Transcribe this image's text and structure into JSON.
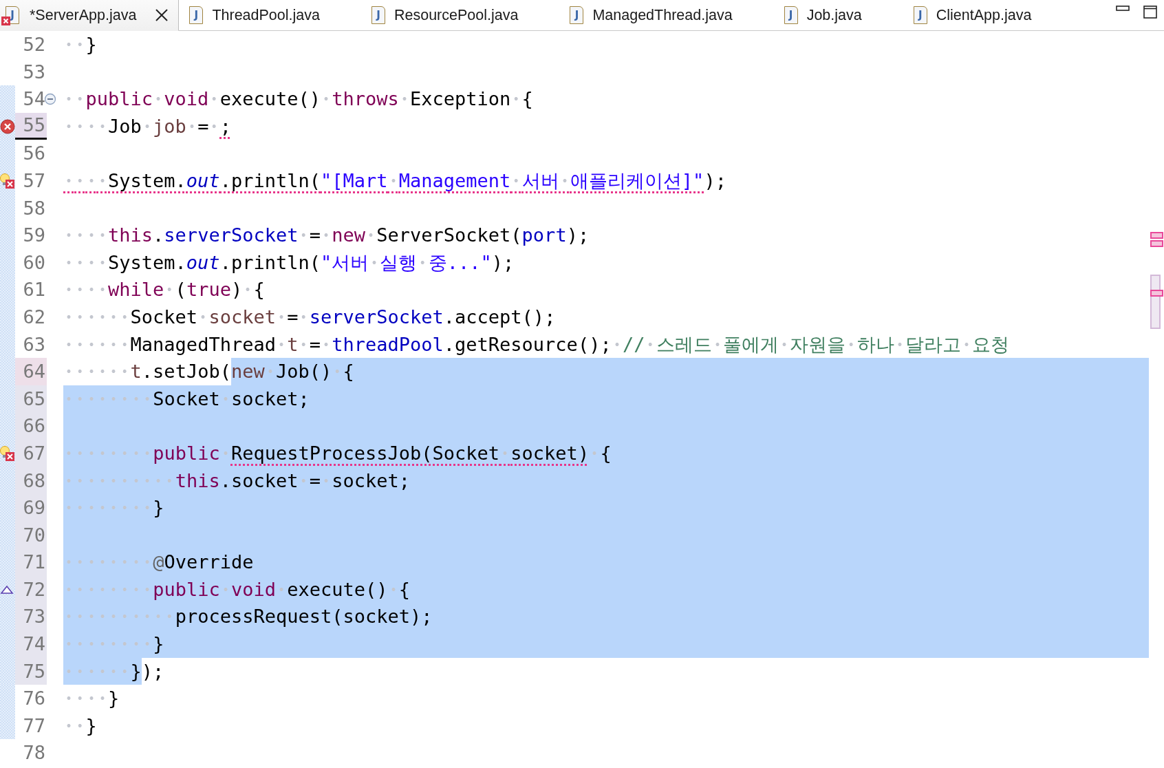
{
  "tabs": [
    {
      "icon": "J",
      "label": "*ServerApp.java",
      "selected": true,
      "error": true
    },
    {
      "icon": "J",
      "label": "ThreadPool.java",
      "selected": false,
      "error": false
    },
    {
      "icon": "J",
      "label": "ResourcePool.java",
      "selected": false,
      "error": false
    },
    {
      "icon": "J",
      "label": "ManagedThread.java",
      "selected": false,
      "error": false
    },
    {
      "icon": "J",
      "label": "Job.java",
      "selected": false,
      "error": false
    },
    {
      "icon": "J",
      "label": "ClientApp.java",
      "selected": false,
      "error": false
    }
  ],
  "lines": [
    {
      "number": "52",
      "current": false,
      "caret": false,
      "in_selection": false,
      "in_scope": false,
      "selected_eol": false,
      "tokens": [
        {
          "kind": "plain",
          "text": "  }",
          "selected": false,
          "squiggle": false
        }
      ]
    },
    {
      "number": "53",
      "current": false,
      "caret": false,
      "in_selection": false,
      "in_scope": false,
      "selected_eol": false
    },
    {
      "number": "54",
      "current": false,
      "caret": false,
      "in_selection": false,
      "in_scope": true,
      "markers": [
        {
          "kind": "fold"
        }
      ],
      "selected_eol": false,
      "tokens": [
        {
          "kind": "keyword",
          "text": "  public",
          "selected": false,
          "squiggle": false
        },
        {
          "kind": "keyword",
          "text": " void",
          "selected": false,
          "squiggle": false
        },
        {
          "kind": "plain",
          "text": " execute() ",
          "selected": false,
          "squiggle": false
        },
        {
          "kind": "keyword",
          "text": "throws",
          "selected": false,
          "squiggle": false
        },
        {
          "kind": "plain",
          "text": " Exception {",
          "selected": false,
          "squiggle": false
        }
      ]
    },
    {
      "number": "55",
      "current": true,
      "caret": false,
      "in_selection": false,
      "in_scope": true,
      "markers": [
        {
          "kind": "error"
        }
      ],
      "selected_eol": false,
      "tokens": [
        {
          "kind": "plain",
          "text": "    Job ",
          "selected": false,
          "squiggle": false
        },
        {
          "kind": "local",
          "text": "job",
          "selected": false,
          "squiggle": false
        },
        {
          "kind": "plain",
          "text": " = ",
          "selected": false,
          "squiggle": false
        },
        {
          "kind": "plain",
          "text": ";",
          "selected": false,
          "squiggle": true
        }
      ]
    },
    {
      "number": "56",
      "current": false,
      "caret": false,
      "in_selection": false,
      "in_scope": true,
      "selected_eol": false
    },
    {
      "number": "57",
      "current": false,
      "caret": false,
      "in_selection": false,
      "in_scope": true,
      "markers": [
        {
          "kind": "quickfix-error"
        }
      ],
      "selected_eol": false,
      "tokens": [
        {
          "kind": "plain",
          "text": "    System.",
          "selected": false,
          "squiggle": true
        },
        {
          "kind": "static",
          "text": "out",
          "selected": false,
          "squiggle": true
        },
        {
          "kind": "plain",
          "text": ".println(",
          "selected": false,
          "squiggle": true
        },
        {
          "kind": "string",
          "text": "\"[Mart Management 서버 애플리케이션]\"",
          "selected": false,
          "squiggle": true
        },
        {
          "kind": "plain",
          "text": ");",
          "selected": false,
          "squiggle": false
        }
      ]
    },
    {
      "number": "58",
      "current": false,
      "caret": false,
      "in_selection": false,
      "in_scope": true,
      "selected_eol": false
    },
    {
      "number": "59",
      "current": false,
      "caret": false,
      "in_selection": false,
      "in_scope": true,
      "selected_eol": false,
      "tokens": [
        {
          "kind": "keyword",
          "text": "    this",
          "selected": false,
          "squiggle": false
        },
        {
          "kind": "plain",
          "text": ".",
          "selected": false,
          "squiggle": false
        },
        {
          "kind": "field",
          "text": "serverSocket",
          "selected": false,
          "squiggle": false
        },
        {
          "kind": "plain",
          "text": " = ",
          "selected": false,
          "squiggle": false
        },
        {
          "kind": "keyword",
          "text": "new",
          "selected": false,
          "squiggle": false
        },
        {
          "kind": "plain",
          "text": " ServerSocket(",
          "selected": false,
          "squiggle": false
        },
        {
          "kind": "field",
          "text": "port",
          "selected": false,
          "squiggle": false
        },
        {
          "kind": "plain",
          "text": ");",
          "selected": false,
          "squiggle": false
        }
      ]
    },
    {
      "number": "60",
      "current": false,
      "caret": false,
      "in_selection": false,
      "in_scope": true,
      "selected_eol": false,
      "tokens": [
        {
          "kind": "plain",
          "text": "    System.",
          "selected": false,
          "squiggle": false
        },
        {
          "kind": "static",
          "text": "out",
          "selected": false,
          "squiggle": false
        },
        {
          "kind": "plain",
          "text": ".println(",
          "selected": false,
          "squiggle": false
        },
        {
          "kind": "string",
          "text": "\"서버 실행 중...\"",
          "selected": false,
          "squiggle": false
        },
        {
          "kind": "plain",
          "text": ");",
          "selected": false,
          "squiggle": false
        }
      ]
    },
    {
      "number": "61",
      "current": false,
      "caret": false,
      "in_selection": false,
      "in_scope": true,
      "selected_eol": false,
      "tokens": [
        {
          "kind": "keyword",
          "text": "    while",
          "selected": false,
          "squiggle": false
        },
        {
          "kind": "plain",
          "text": " (",
          "selected": false,
          "squiggle": false
        },
        {
          "kind": "keyword",
          "text": "true",
          "selected": false,
          "squiggle": false
        },
        {
          "kind": "plain",
          "text": ") {",
          "selected": false,
          "squiggle": false
        }
      ]
    },
    {
      "number": "62",
      "current": false,
      "caret": false,
      "in_selection": false,
      "in_scope": true,
      "selected_eol": false,
      "tokens": [
        {
          "kind": "plain",
          "text": "      Socket ",
          "selected": false,
          "squiggle": false
        },
        {
          "kind": "local",
          "text": "socket",
          "selected": false,
          "squiggle": false
        },
        {
          "kind": "plain",
          "text": " = ",
          "selected": false,
          "squiggle": false
        },
        {
          "kind": "field",
          "text": "serverSocket",
          "selected": false,
          "squiggle": false
        },
        {
          "kind": "plain",
          "text": ".accept();",
          "selected": false,
          "squiggle": false
        }
      ]
    },
    {
      "number": "63",
      "current": false,
      "caret": false,
      "in_selection": false,
      "in_scope": true,
      "selected_eol": false,
      "tokens": [
        {
          "kind": "plain",
          "text": "      ManagedThread ",
          "selected": false,
          "squiggle": false
        },
        {
          "kind": "local",
          "text": "t",
          "selected": false,
          "squiggle": false
        },
        {
          "kind": "plain",
          "text": " = ",
          "selected": false,
          "squiggle": false
        },
        {
          "kind": "field",
          "text": "threadPool",
          "selected": false,
          "squiggle": false
        },
        {
          "kind": "plain",
          "text": ".getResource(); ",
          "selected": false,
          "squiggle": false
        },
        {
          "kind": "comment",
          "text": "// 스레드 풀에게 자원을 하나 달라고 요청",
          "selected": false,
          "squiggle": false
        }
      ]
    },
    {
      "number": "64",
      "current": false,
      "caret": true,
      "in_selection": true,
      "in_scope": true,
      "selected_eol": true,
      "tokens": [
        {
          "kind": "local",
          "text": "      t",
          "selected": false,
          "squiggle": false
        },
        {
          "kind": "plain",
          "text": ".setJob(",
          "selected": false,
          "squiggle": false
        },
        {
          "kind": "local",
          "text": "new",
          "selected": true,
          "squiggle": false
        },
        {
          "kind": "plain",
          "text": " Job() {",
          "selected": true,
          "squiggle": false
        }
      ]
    },
    {
      "number": "65",
      "current": false,
      "caret": false,
      "in_selection": true,
      "in_scope": true,
      "selected_eol": true,
      "tokens": [
        {
          "kind": "plain",
          "text": "        Socket socket;",
          "selected": true,
          "squiggle": false
        }
      ]
    },
    {
      "number": "66",
      "current": false,
      "caret": false,
      "in_selection": true,
      "in_scope": true,
      "selected_eol": true
    },
    {
      "number": "67",
      "current": false,
      "caret": false,
      "in_selection": true,
      "in_scope": true,
      "markers": [
        {
          "kind": "quickfix-error"
        }
      ],
      "selected_eol": true,
      "tokens": [
        {
          "kind": "keyword",
          "text": "        public ",
          "selected": true,
          "squiggle": false
        },
        {
          "kind": "plain",
          "text": "RequestProcessJob(Socket socket)",
          "selected": true,
          "squiggle": true
        },
        {
          "kind": "plain",
          "text": " {",
          "selected": true,
          "squiggle": false
        }
      ]
    },
    {
      "number": "68",
      "current": false,
      "caret": false,
      "in_selection": true,
      "in_scope": true,
      "selected_eol": true,
      "tokens": [
        {
          "kind": "keyword",
          "text": "          this",
          "selected": true,
          "squiggle": false
        },
        {
          "kind": "plain",
          "text": ".socket = socket;",
          "selected": true,
          "squiggle": false
        }
      ]
    },
    {
      "number": "69",
      "current": false,
      "caret": false,
      "in_selection": true,
      "in_scope": true,
      "selected_eol": true,
      "tokens": [
        {
          "kind": "plain",
          "text": "        }",
          "selected": true,
          "squiggle": false
        }
      ]
    },
    {
      "number": "70",
      "current": false,
      "caret": false,
      "in_selection": true,
      "in_scope": true,
      "selected_eol": true
    },
    {
      "number": "71",
      "current": false,
      "caret": false,
      "in_selection": true,
      "in_scope": true,
      "selected_eol": true,
      "tokens": [
        {
          "kind": "annotation",
          "text": "        @",
          "selected": true,
          "squiggle": false
        },
        {
          "kind": "plain",
          "text": "Override",
          "selected": true,
          "squiggle": false
        }
      ]
    },
    {
      "number": "72",
      "current": false,
      "caret": false,
      "in_selection": true,
      "in_scope": true,
      "markers": [
        {
          "kind": "override"
        }
      ],
      "selected_eol": true,
      "tokens": [
        {
          "kind": "keyword",
          "text": "        public void",
          "selected": true,
          "squiggle": false
        },
        {
          "kind": "plain",
          "text": " execute() {",
          "selected": true,
          "squiggle": false
        }
      ]
    },
    {
      "number": "73",
      "current": false,
      "caret": false,
      "in_selection": true,
      "in_scope": true,
      "selected_eol": true,
      "tokens": [
        {
          "kind": "plain",
          "text": "          processRequest(socket);",
          "selected": true,
          "squiggle": false
        }
      ]
    },
    {
      "number": "74",
      "current": false,
      "caret": false,
      "in_selection": true,
      "in_scope": true,
      "selected_eol": true,
      "tokens": [
        {
          "kind": "plain",
          "text": "        }",
          "selected": true,
          "squiggle": false
        }
      ]
    },
    {
      "number": "75",
      "current": false,
      "caret": false,
      "in_selection": true,
      "in_scope": true,
      "selected_eol": false,
      "tokens": [
        {
          "kind": "plain",
          "text": "      }",
          "selected": true,
          "squiggle": false
        },
        {
          "kind": "plain",
          "text": ");",
          "selected": false,
          "squiggle": false
        }
      ]
    },
    {
      "number": "76",
      "current": false,
      "caret": false,
      "in_selection": false,
      "in_scope": true,
      "selected_eol": false,
      "tokens": [
        {
          "kind": "plain",
          "text": "    }",
          "selected": false,
          "squiggle": false
        }
      ]
    },
    {
      "number": "77",
      "current": false,
      "caret": false,
      "in_selection": false,
      "in_scope": true,
      "selected_eol": false,
      "tokens": [
        {
          "kind": "plain",
          "text": "  }",
          "selected": false,
          "squiggle": false
        }
      ]
    },
    {
      "number": "78",
      "current": false,
      "caret": false,
      "in_selection": false,
      "in_scope": false,
      "selected_eol": false
    }
  ]
}
